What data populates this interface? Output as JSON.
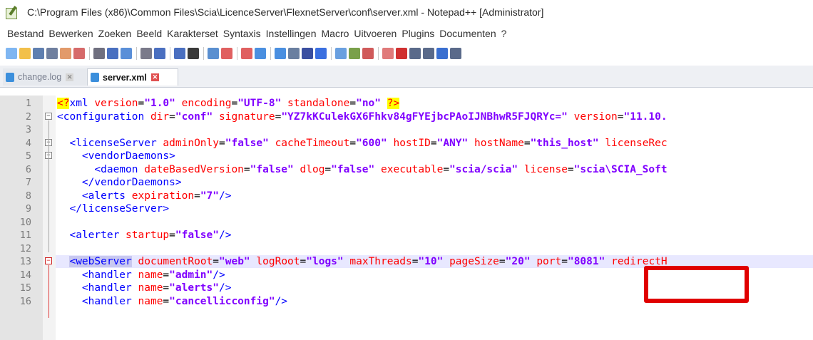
{
  "window": {
    "title": "C:\\Program Files (x86)\\Common Files\\Scia\\LicenceServer\\FlexnetServer\\conf\\server.xml - Notepad++ [Administrator]"
  },
  "menu": {
    "items": [
      "Bestand",
      "Bewerken",
      "Zoeken",
      "Beeld",
      "Karakterset",
      "Syntaxis",
      "Instellingen",
      "Macro",
      "Uitvoeren",
      "Plugins",
      "Documenten",
      "?"
    ]
  },
  "tabs": [
    {
      "label": "change.log",
      "active": false
    },
    {
      "label": "server.xml",
      "active": true
    }
  ],
  "editor": {
    "lines": [
      {
        "n": "1",
        "tokens": [
          {
            "t": "<?",
            "c": "pi"
          },
          {
            "t": "xml ",
            "c": "tag"
          },
          {
            "t": "version",
            "c": "attr"
          },
          {
            "t": "=",
            "c": "eq"
          },
          {
            "t": "\"1.0\"",
            "c": "val"
          },
          {
            "t": " ",
            "c": "eq"
          },
          {
            "t": "encoding",
            "c": "attr"
          },
          {
            "t": "=",
            "c": "eq"
          },
          {
            "t": "\"UTF-8\"",
            "c": "val"
          },
          {
            "t": " ",
            "c": "eq"
          },
          {
            "t": "standalone",
            "c": "attr"
          },
          {
            "t": "=",
            "c": "eq"
          },
          {
            "t": "\"no\"",
            "c": "val"
          },
          {
            "t": " ",
            "c": "eq"
          },
          {
            "t": "?>",
            "c": "pi"
          }
        ]
      },
      {
        "n": "2",
        "tokens": [
          {
            "t": "<configuration ",
            "c": "tag"
          },
          {
            "t": "dir",
            "c": "attr"
          },
          {
            "t": "=",
            "c": "eq"
          },
          {
            "t": "\"conf\"",
            "c": "val"
          },
          {
            "t": " ",
            "c": "eq"
          },
          {
            "t": "signature",
            "c": "attr"
          },
          {
            "t": "=",
            "c": "eq"
          },
          {
            "t": "\"YZ7kKCulekGX6Fhkv84gFYEjbcPAoIJNBhwR5FJQRYc=\"",
            "c": "val"
          },
          {
            "t": " ",
            "c": "eq"
          },
          {
            "t": "version",
            "c": "attr"
          },
          {
            "t": "=",
            "c": "eq"
          },
          {
            "t": "\"11.10.",
            "c": "val"
          }
        ]
      },
      {
        "n": "3",
        "tokens": []
      },
      {
        "n": "4",
        "tokens": [
          {
            "t": "  ",
            "c": "eq"
          },
          {
            "t": "<licenseServer ",
            "c": "tag"
          },
          {
            "t": "adminOnly",
            "c": "attr"
          },
          {
            "t": "=",
            "c": "eq"
          },
          {
            "t": "\"false\"",
            "c": "val"
          },
          {
            "t": " ",
            "c": "eq"
          },
          {
            "t": "cacheTimeout",
            "c": "attr"
          },
          {
            "t": "=",
            "c": "eq"
          },
          {
            "t": "\"600\"",
            "c": "val"
          },
          {
            "t": " ",
            "c": "eq"
          },
          {
            "t": "hostID",
            "c": "attr"
          },
          {
            "t": "=",
            "c": "eq"
          },
          {
            "t": "\"ANY\"",
            "c": "val"
          },
          {
            "t": " ",
            "c": "eq"
          },
          {
            "t": "hostName",
            "c": "attr"
          },
          {
            "t": "=",
            "c": "eq"
          },
          {
            "t": "\"this_host\"",
            "c": "val"
          },
          {
            "t": " ",
            "c": "eq"
          },
          {
            "t": "licenseRec",
            "c": "attr"
          }
        ]
      },
      {
        "n": "5",
        "tokens": [
          {
            "t": "    ",
            "c": "eq"
          },
          {
            "t": "<vendorDaemons>",
            "c": "tag"
          }
        ]
      },
      {
        "n": "6",
        "tokens": [
          {
            "t": "      ",
            "c": "eq"
          },
          {
            "t": "<daemon ",
            "c": "tag"
          },
          {
            "t": "dateBasedVersion",
            "c": "attr"
          },
          {
            "t": "=",
            "c": "eq"
          },
          {
            "t": "\"false\"",
            "c": "val"
          },
          {
            "t": " ",
            "c": "eq"
          },
          {
            "t": "dlog",
            "c": "attr"
          },
          {
            "t": "=",
            "c": "eq"
          },
          {
            "t": "\"false\"",
            "c": "val"
          },
          {
            "t": " ",
            "c": "eq"
          },
          {
            "t": "executable",
            "c": "attr"
          },
          {
            "t": "=",
            "c": "eq"
          },
          {
            "t": "\"scia/scia\"",
            "c": "val"
          },
          {
            "t": " ",
            "c": "eq"
          },
          {
            "t": "license",
            "c": "attr"
          },
          {
            "t": "=",
            "c": "eq"
          },
          {
            "t": "\"scia\\SCIA_Soft",
            "c": "val"
          }
        ]
      },
      {
        "n": "7",
        "tokens": [
          {
            "t": "    ",
            "c": "eq"
          },
          {
            "t": "</vendorDaemons>",
            "c": "tag"
          }
        ]
      },
      {
        "n": "8",
        "tokens": [
          {
            "t": "    ",
            "c": "eq"
          },
          {
            "t": "<alerts ",
            "c": "tag"
          },
          {
            "t": "expiration",
            "c": "attr"
          },
          {
            "t": "=",
            "c": "eq"
          },
          {
            "t": "\"7\"",
            "c": "val"
          },
          {
            "t": "/>",
            "c": "tag"
          }
        ]
      },
      {
        "n": "9",
        "tokens": [
          {
            "t": "  ",
            "c": "eq"
          },
          {
            "t": "</licenseServer>",
            "c": "tag"
          }
        ]
      },
      {
        "n": "10",
        "tokens": []
      },
      {
        "n": "11",
        "tokens": [
          {
            "t": "  ",
            "c": "eq"
          },
          {
            "t": "<alerter ",
            "c": "tag"
          },
          {
            "t": "startup",
            "c": "attr"
          },
          {
            "t": "=",
            "c": "eq"
          },
          {
            "t": "\"false\"",
            "c": "val"
          },
          {
            "t": "/>",
            "c": "tag"
          }
        ]
      },
      {
        "n": "12",
        "tokens": []
      },
      {
        "n": "13",
        "tokens": [
          {
            "t": "  ",
            "c": "eq"
          },
          {
            "t": "<webServer",
            "c": "tag-hl"
          },
          {
            "t": " ",
            "c": "eq"
          },
          {
            "t": "documentRoot",
            "c": "attr"
          },
          {
            "t": "=",
            "c": "eq"
          },
          {
            "t": "\"web\"",
            "c": "val"
          },
          {
            "t": " ",
            "c": "eq"
          },
          {
            "t": "logRoot",
            "c": "attr"
          },
          {
            "t": "=",
            "c": "eq"
          },
          {
            "t": "\"logs\"",
            "c": "val"
          },
          {
            "t": " ",
            "c": "eq"
          },
          {
            "t": "maxThreads",
            "c": "attr"
          },
          {
            "t": "=",
            "c": "eq"
          },
          {
            "t": "\"10\"",
            "c": "val"
          },
          {
            "t": " ",
            "c": "eq"
          },
          {
            "t": "pageSize",
            "c": "attr"
          },
          {
            "t": "=",
            "c": "eq"
          },
          {
            "t": "\"20\"",
            "c": "val"
          },
          {
            "t": " ",
            "c": "eq"
          },
          {
            "t": "port",
            "c": "attr"
          },
          {
            "t": "=",
            "c": "eq"
          },
          {
            "t": "\"8081\"",
            "c": "val"
          },
          {
            "t": " ",
            "c": "eq"
          },
          {
            "t": "redirectH",
            "c": "attr"
          }
        ]
      },
      {
        "n": "14",
        "tokens": [
          {
            "t": "    ",
            "c": "eq"
          },
          {
            "t": "<handler ",
            "c": "tag"
          },
          {
            "t": "name",
            "c": "attr"
          },
          {
            "t": "=",
            "c": "eq"
          },
          {
            "t": "\"admin\"",
            "c": "val"
          },
          {
            "t": "/>",
            "c": "tag"
          }
        ]
      },
      {
        "n": "15",
        "tokens": [
          {
            "t": "    ",
            "c": "eq"
          },
          {
            "t": "<handler ",
            "c": "tag"
          },
          {
            "t": "name",
            "c": "attr"
          },
          {
            "t": "=",
            "c": "eq"
          },
          {
            "t": "\"alerts\"",
            "c": "val"
          },
          {
            "t": "/>",
            "c": "tag"
          }
        ]
      },
      {
        "n": "16",
        "tokens": [
          {
            "t": "    ",
            "c": "eq"
          },
          {
            "t": "<handler ",
            "c": "tag"
          },
          {
            "t": "name",
            "c": "attr"
          },
          {
            "t": "=",
            "c": "eq"
          },
          {
            "t": "\"cancellicconfig\"",
            "c": "val"
          },
          {
            "t": "/>",
            "c": "tag"
          }
        ]
      }
    ],
    "highlighted_line": "13",
    "annotation": "red-box-around-port-8081"
  },
  "colors": {
    "tag": "#0000ff",
    "attribute": "#ff0000",
    "value": "#8000ff",
    "highlight": "#e8e8ff",
    "annotation": "#e00000"
  },
  "toolbar_icons": [
    "new-icon",
    "open-icon",
    "save-icon",
    "save-all-icon",
    "close-icon",
    "close-all-icon",
    "print-icon",
    "cut-icon",
    "copy-icon",
    "paste-icon",
    "undo-icon",
    "redo-icon",
    "find-icon",
    "replace-icon",
    "zoom-in-icon",
    "zoom-out-icon",
    "sync-v-icon",
    "sync-h-icon",
    "wrap-icon",
    "all-chars-icon",
    "indent-guide-icon",
    "doc-map-icon",
    "function-list-icon",
    "folder-icon",
    "monitor-icon",
    "record-macro-icon",
    "stop-macro-icon",
    "play-macro-icon",
    "run-multiple-icon",
    "save-macro-icon"
  ]
}
